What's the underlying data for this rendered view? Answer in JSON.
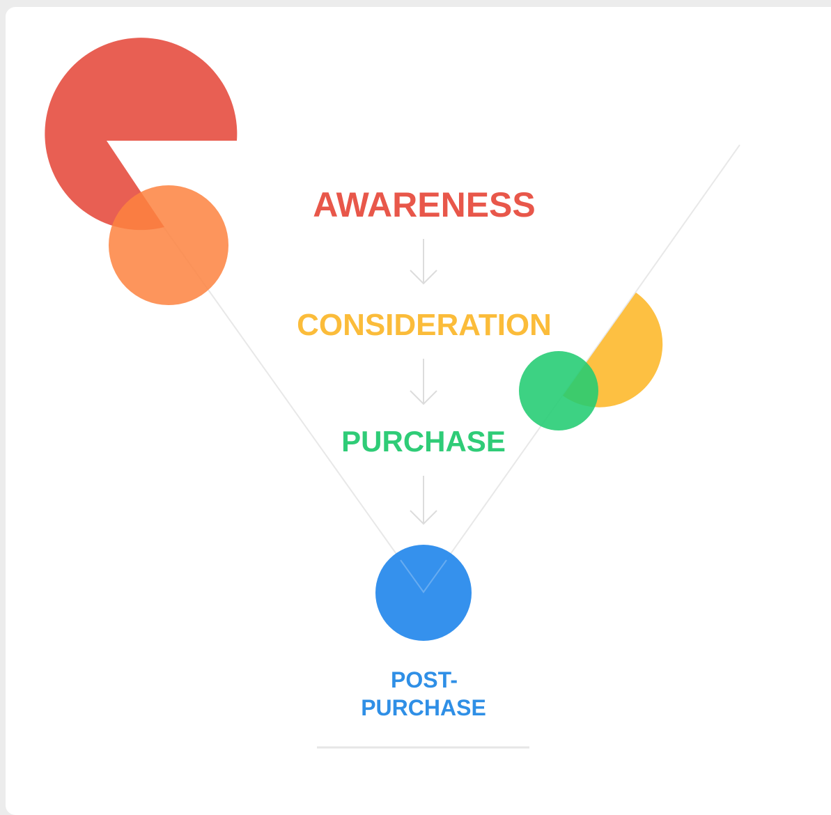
{
  "stages": [
    {
      "label": "AWARENESS",
      "color": "#e8574a"
    },
    {
      "label": "CONSIDERATION",
      "color": "#fbbc3a"
    },
    {
      "label": "PURCHASE",
      "color": "#2fcc77"
    },
    {
      "label_lines": [
        "POST-",
        "PURCHASE"
      ],
      "color": "#2f8fe6"
    }
  ],
  "shapes": {
    "red": "#e64e40",
    "orange": "#fd8240",
    "yellow": "#fdb92e",
    "green": "#22cc72",
    "blue": "#2488ec",
    "funnel_line": "#e8e8e8",
    "arrow": "#dcdcdc",
    "divider": "#e6e6e6"
  }
}
